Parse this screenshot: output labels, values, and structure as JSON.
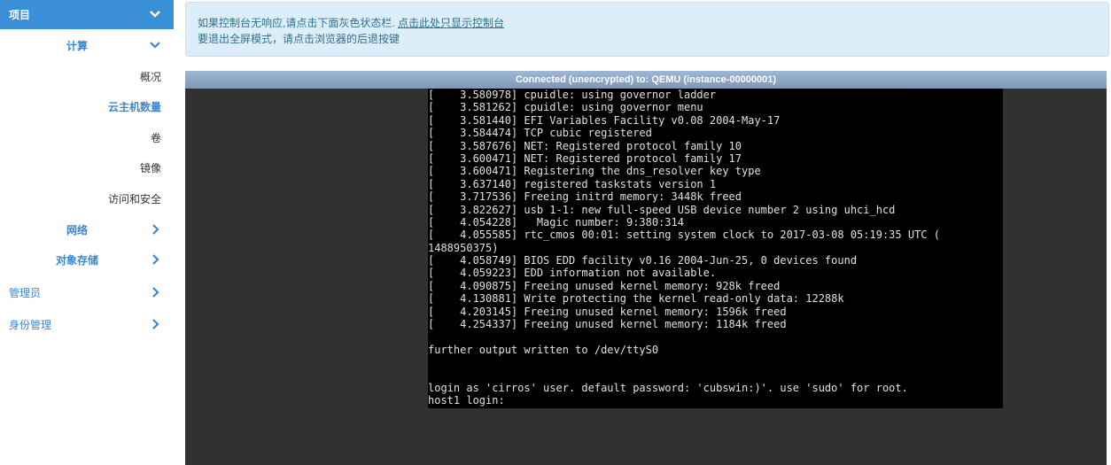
{
  "sidebar": {
    "project": {
      "label": "项目"
    },
    "compute": {
      "label": "计算"
    },
    "overview": {
      "label": "概况"
    },
    "instances": {
      "label": "云主机数量"
    },
    "volumes": {
      "label": "卷"
    },
    "images": {
      "label": "镜像"
    },
    "access": {
      "label": "访问和安全"
    },
    "network": {
      "label": "网络"
    },
    "object_store": {
      "label": "对象存储"
    },
    "admin": {
      "label": "管理员"
    },
    "identity": {
      "label": "身份管理"
    }
  },
  "alert": {
    "line1_text": "如果控制台无响应,请点击下面灰色状态栏. ",
    "line1_link": "点击此处只显示控制台",
    "line2": "要退出全屏模式，请点击浏览器的后退按键"
  },
  "console": {
    "status": "Connected (unencrypted) to: QEMU (instance-00000001)",
    "lines": [
      "[    3.580978] cpuidle: using governor ladder",
      "[    3.581262] cpuidle: using governor menu",
      "[    3.581440] EFI Variables Facility v0.08 2004-May-17",
      "[    3.584474] TCP cubic registered",
      "[    3.587676] NET: Registered protocol family 10",
      "[    3.600471] NET: Registered protocol family 17",
      "[    3.600471] Registering the dns_resolver key type",
      "[    3.637140] registered taskstats version 1",
      "[    3.717536] Freeing initrd memory: 3448k freed",
      "[    3.822627] usb 1-1: new full-speed USB device number 2 using uhci_hcd",
      "[    4.054228]   Magic number: 9:380:314",
      "[    4.055585] rtc_cmos 00:01: setting system clock to 2017-03-08 05:19:35 UTC (",
      "1488950375)",
      "[    4.058749] BIOS EDD facility v0.16 2004-Jun-25, 0 devices found",
      "[    4.059223] EDD information not available.",
      "[    4.090875] Freeing unused kernel memory: 928k freed",
      "[    4.130881] Write protecting the kernel read-only data: 12288k",
      "[    4.203145] Freeing unused kernel memory: 1596k freed",
      "[    4.254337] Freeing unused kernel memory: 1184k freed",
      "",
      "further output written to /dev/ttyS0",
      "",
      "",
      "login as 'cirros' user. default password: 'cubswin:)'. use 'sudo' for root.",
      "host1 login:"
    ]
  },
  "colors": {
    "accent": "#3b8fd6",
    "alert_bg": "#dceef8",
    "console_bg": "#313131",
    "terminal_bg": "#000000"
  }
}
